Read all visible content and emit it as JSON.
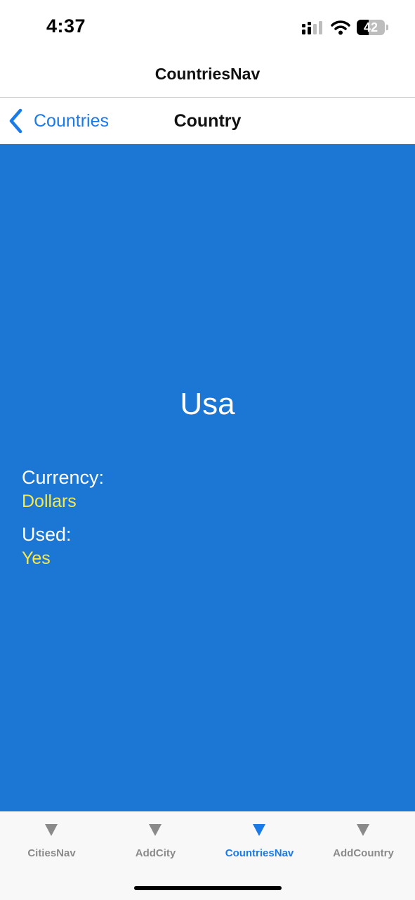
{
  "status_bar": {
    "time": "4:37",
    "battery_percent": 42,
    "battery_label": "42",
    "signal_icon": "cellular-signal-icon",
    "wifi_icon": "wifi-icon"
  },
  "outer_nav": {
    "title": "CountriesNav"
  },
  "inner_nav": {
    "back_label": "Countries",
    "back_icon": "chevron-left-icon",
    "title": "Country"
  },
  "country": {
    "name": "Usa",
    "currency_label": "Currency:",
    "currency_value": "Dollars",
    "used_label": "Used:",
    "used_value": "Yes"
  },
  "tab_bar": {
    "active_tab": "CountriesNav",
    "tabs": [
      {
        "label": "CitiesNav",
        "icon": "triangle-down-icon"
      },
      {
        "label": "AddCity",
        "icon": "triangle-down-icon"
      },
      {
        "label": "CountriesNav",
        "icon": "triangle-down-icon"
      },
      {
        "label": "AddCountry",
        "icon": "triangle-down-icon"
      }
    ]
  },
  "colors": {
    "content_background": "#1b76d4",
    "accent": "#1a7ae8",
    "value_text": "#f7e94a",
    "inactive_tab": "#8a8a8a"
  }
}
